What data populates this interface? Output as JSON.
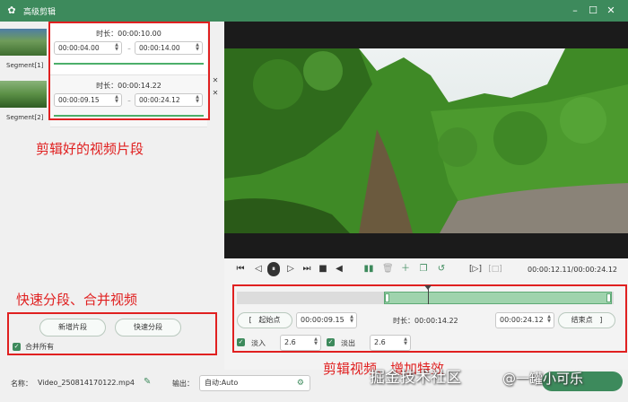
{
  "app": {
    "title": "高级剪辑"
  },
  "segments": [
    {
      "thumb_label": "Segment[1]",
      "duration": "时长：00:00:10.00",
      "start": "00:00:04.00",
      "end": "00:00:14.00"
    },
    {
      "thumb_label": "Segment[2]",
      "duration": "时长：00:00:14.22",
      "start": "00:00:09.15",
      "end": "00:00:24.12"
    }
  ],
  "annotations": {
    "segments_note": "剪辑好的视频片段",
    "split_note": "快速分段、合并视频",
    "edit_note": "剪辑视频、增加特效"
  },
  "left_actions": {
    "add_segment": "新增片段",
    "quick_split": "快速分段",
    "merge_all": "合并所有"
  },
  "player": {
    "timecode": "00:00:12.11/00:00:24.12"
  },
  "trim": {
    "start_label": "起始点",
    "start_value": "00:00:09.15",
    "duration_label": "时长：00:00:14.22",
    "end_value": "00:00:24.12",
    "end_label": "结束点",
    "bracket_open": "[",
    "bracket_close": "]"
  },
  "effects": {
    "fade_in_label": "淡入",
    "fade_in_value": "2.6",
    "fade_out_label": "淡出",
    "fade_out_value": "2.6"
  },
  "footer": {
    "name_label": "名称：",
    "name_value": "Video_250814170122.mp4",
    "output_label": "输出：",
    "output_value": "自动:Auto"
  },
  "watermark": {
    "left": "掘金技术社区",
    "right": "@一罐小可乐"
  },
  "colors": {
    "accent": "#3d8a5c",
    "annotation": "#e02020",
    "timeline_select": "#9fd3ad"
  }
}
